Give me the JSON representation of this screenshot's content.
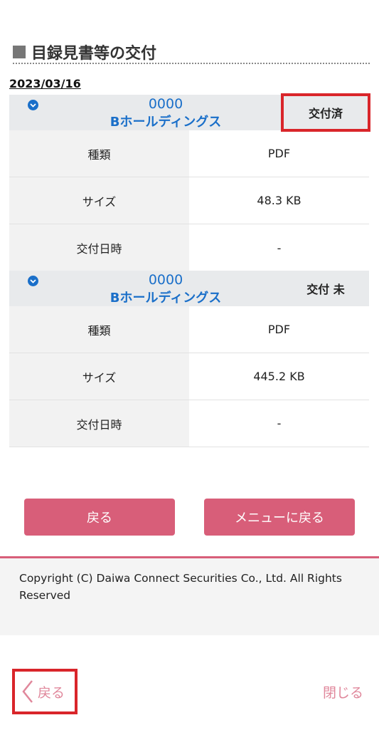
{
  "page": {
    "title": "目録見書等の交付"
  },
  "date": "2023/03/16",
  "documents": [
    {
      "code": "0000",
      "name": "Bホールディングス",
      "status": "交付済",
      "rows": [
        {
          "label": "種類",
          "value": "PDF"
        },
        {
          "label": "サイズ",
          "value": "48.3 KB"
        },
        {
          "label": "交付日時",
          "value": "-"
        }
      ]
    },
    {
      "code": "0000",
      "name": "Bホールディングス",
      "status": "交付 未",
      "rows": [
        {
          "label": "種類",
          "value": "PDF"
        },
        {
          "label": "サイズ",
          "value": "445.2 KB"
        },
        {
          "label": "交付日時",
          "value": "-"
        }
      ]
    }
  ],
  "actions": {
    "back_label": "戻る",
    "menu_label": "メニューに戻る"
  },
  "footer": {
    "copyright": "Copyright (C) Daiwa Connect Securities Co., Ltd. All Rights Reserved"
  },
  "bottom_bar": {
    "back_label": "戻る",
    "close_label": "閉じる"
  },
  "icons": {
    "expand": "chevron-down-icon",
    "back": "chevron-left-icon"
  },
  "colors": {
    "accent": "#d85e79",
    "link": "#1a6fc9",
    "highlight": "#d9252a"
  }
}
